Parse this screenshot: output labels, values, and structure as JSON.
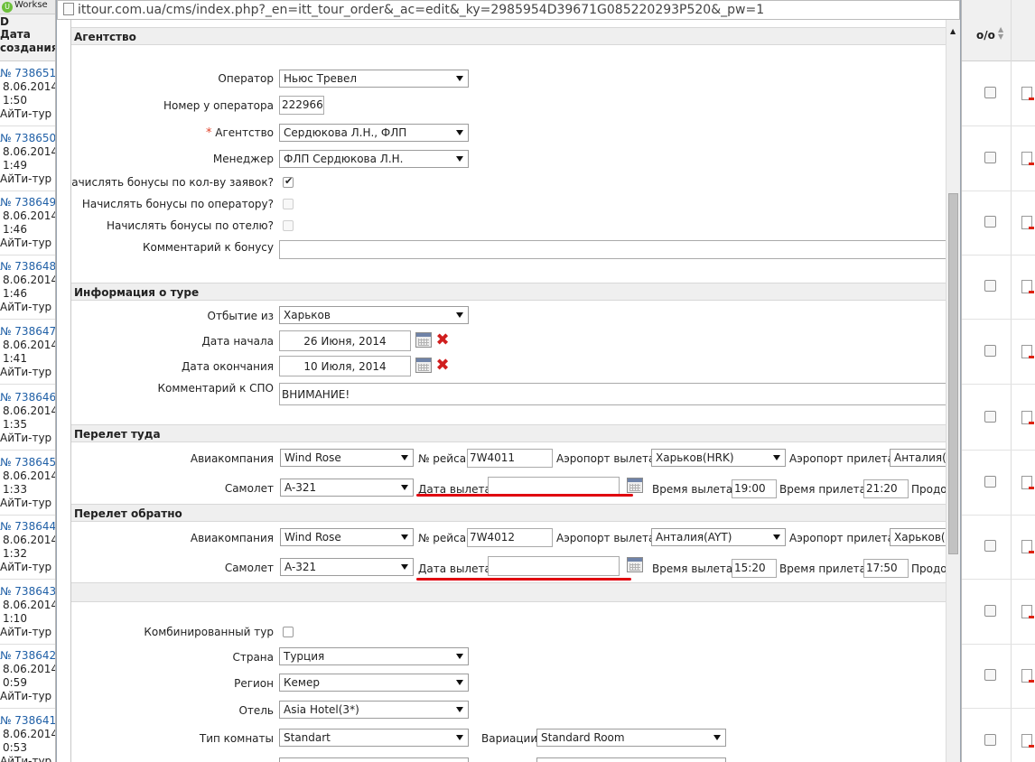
{
  "left_list": {
    "tab_label": "Workse",
    "header": [
      "D",
      "Дата",
      "создания"
    ],
    "rows": [
      {
        "num": "№ 738651",
        "date": "8.06.2014",
        "time": "1:50",
        "agent": "АйТи-тур"
      },
      {
        "num": "№ 738650",
        "date": "8.06.2014",
        "time": "1:49",
        "agent": "АйТи-тур"
      },
      {
        "num": "№ 738649",
        "date": "8.06.2014",
        "time": "1:46",
        "agent": "АйТи-тур"
      },
      {
        "num": "№ 738648",
        "date": "8.06.2014",
        "time": "1:46",
        "agent": "АйТи-тур"
      },
      {
        "num": "№ 738647",
        "date": "8.06.2014",
        "time": "1:41",
        "agent": "АйТи-тур"
      },
      {
        "num": "№ 738646",
        "date": "8.06.2014",
        "time": "1:35",
        "agent": "АйТи-тур"
      },
      {
        "num": "№ 738645",
        "date": "8.06.2014",
        "time": "1:33",
        "agent": "АйТи-тур"
      },
      {
        "num": "№ 738644",
        "date": "8.06.2014",
        "time": "1:32",
        "agent": "АйТи-тур"
      },
      {
        "num": "№ 738643",
        "date": "8.06.2014",
        "time": "1:10",
        "agent": "АйТи-тур"
      },
      {
        "num": "№ 738642",
        "date": "8.06.2014",
        "time": "0:59",
        "agent": "АйТи-тур"
      },
      {
        "num": "№ 738641",
        "date": "8.06.2014",
        "time": "0:53",
        "agent": "АйТи-тур"
      }
    ]
  },
  "right_list": {
    "header": "о/о"
  },
  "browser": {
    "url": "ittour.com.ua/cms/index.php?_en=itt_tour_order&_ac=edit&_ky=2985954D39671G085220293P520&_pw=1"
  },
  "agency": {
    "section_title": "Агентство",
    "operator_label": "Оператор",
    "operator_value": "Ньюс Тревел",
    "op_number_label": "Номер у оператора",
    "op_number_value": "222966",
    "agency_label": "Агентство",
    "agency_value": "Сердюкова Л.Н., ФЛП",
    "manager_label": "Менеджер",
    "manager_value": "ФЛП Сердюкова Л.Н.",
    "bonus_requests_label": "Начислять бонусы по кол-ву заявок?",
    "bonus_operator_label": "Начислять бонусы по оператору?",
    "bonus_hotel_label": "Начислять бонусы по отелю?",
    "bonus_comment_label": "Комментарий к бонусу"
  },
  "tour_info": {
    "section_title": "Информация о туре",
    "departure_label": "Отбытие из",
    "departure_value": "Харьков",
    "start_label": "Дата начала",
    "start_value": "26 Июня, 2014",
    "end_label": "Дата окончания",
    "end_value": "10 Июля, 2014",
    "spo_comment_label": "Комментарий к СПО",
    "spo_comment_value": "ВНИМАНИЕ!"
  },
  "flight_there": {
    "section_title": "Перелет туда",
    "airline_label": "Авиакомпания",
    "airline_value": "Wind Rose",
    "flight_no_label": "№ рейса",
    "flight_no_value": "7W4011",
    "dep_airport_label": "Аэропорт вылета",
    "dep_airport_value": "Харьков(HRK)",
    "arr_airport_label": "Аэропорт прилета",
    "arr_airport_value": "Анталия(А",
    "plane_label": "Самолет",
    "plane_value": "A-321",
    "dep_date_label": "Дата вылета",
    "dep_date_value": "",
    "dep_time_label": "Время вылета",
    "dep_time_value": "19:00",
    "arr_time_label": "Время прилета",
    "arr_time_value": "21:20",
    "duration_partial": "Продо"
  },
  "flight_back": {
    "section_title": "Перелет обратно",
    "airline_label": "Авиакомпания",
    "airline_value": "Wind Rose",
    "flight_no_label": "№ рейса",
    "flight_no_value": "7W4012",
    "dep_airport_label": "Аэропорт вылета",
    "dep_airport_value": "Анталия(AYT)",
    "arr_airport_label": "Аэропорт прилета",
    "arr_airport_value": "Харьков(H",
    "plane_label": "Самолет",
    "plane_value": "A-321",
    "dep_date_label": "Дата вылета",
    "dep_date_value": "",
    "dep_time_label": "Время вылета",
    "dep_time_value": "15:20",
    "arr_time_label": "Время прилета",
    "arr_time_value": "17:50",
    "duration_partial": "Продо"
  },
  "hotel": {
    "combined_label": "Комбинированный тур",
    "country_label": "Страна",
    "country_value": "Турция",
    "region_label": "Регион",
    "region_value": "Кемер",
    "hotel_label": "Отель",
    "hotel_value": "Asia Hotel(3*)",
    "room_type_label": "Тип комнаты",
    "room_type_value": "Standart",
    "variations_label": "Вариации",
    "variations_value": "Standard Room"
  },
  "colors": {
    "accent_red": "#e0000f",
    "link_blue": "#1f5fa6",
    "section_bg": "#efefef"
  }
}
